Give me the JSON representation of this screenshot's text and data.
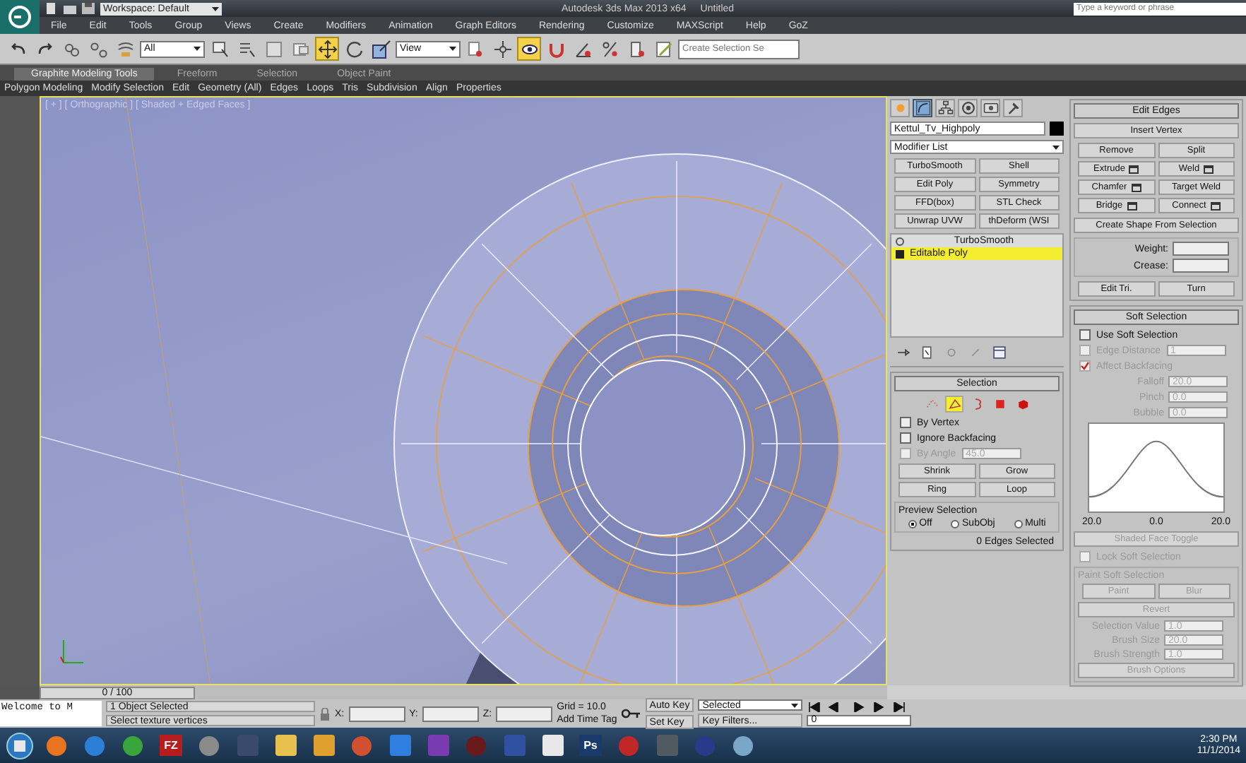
{
  "title_bar": {
    "workspace": "Workspace: Default",
    "title": "Autodesk 3ds Max 2013 x64",
    "document": "Untitled",
    "search": {
      "placeholder": "Type a keyword or phrase"
    }
  },
  "menu": [
    "File",
    "Edit",
    "Tools",
    "Group",
    "Views",
    "Create",
    "Modifiers",
    "Animation",
    "Graph Editors",
    "Rendering",
    "Customize",
    "MAXScript",
    "Help",
    "GoZ"
  ],
  "toolbar": [
    {
      "kind": "undo",
      "selected": false
    },
    {
      "kind": "redo",
      "selected": false
    },
    {
      "kind": "link",
      "selected": false
    },
    {
      "kind": "unlink",
      "selected": false
    },
    {
      "kind": "bind",
      "selected": false
    },
    {
      "kind": "dropdown",
      "value": "All"
    },
    {
      "kind": "select",
      "selected": false
    },
    {
      "kind": "select-name",
      "selected": false
    },
    {
      "kind": "rect",
      "selected": false
    },
    {
      "kind": "window",
      "selected": false
    },
    {
      "kind": "move",
      "selected": true
    },
    {
      "kind": "rotate",
      "selected": false
    },
    {
      "kind": "scale",
      "selected": false
    },
    {
      "kind": "dropdown",
      "value": "View"
    },
    {
      "kind": "pivot",
      "selected": false
    },
    {
      "kind": "manip",
      "selected": false
    },
    {
      "kind": "keyboard",
      "selected": true
    },
    {
      "kind": "snap",
      "selected": false
    },
    {
      "kind": "angle",
      "selected": false
    },
    {
      "kind": "percent",
      "selected": false
    },
    {
      "kind": "spinner",
      "selected": false
    },
    {
      "kind": "named",
      "selected": false
    },
    {
      "kind": "field",
      "placeholder": "Create Selection Se"
    }
  ],
  "ribbon_tabs": [
    {
      "label": "Graphite Modeling Tools",
      "selected": true
    },
    {
      "label": "Freeform",
      "selected": false
    },
    {
      "label": "Selection",
      "selected": false
    },
    {
      "label": "Object Paint",
      "selected": false
    }
  ],
  "ribbon_panels": [
    "Polygon Modeling",
    "Modify Selection",
    "Edit",
    "Geometry (All)",
    "Edges",
    "Loops",
    "Tris",
    "Subdivision",
    "Align",
    "Properties"
  ],
  "viewport": {
    "label": "[ + ] [ Orthographic ] [ Shaded + Edged Faces ]"
  },
  "command_tabs": [
    {
      "kind": "create",
      "selected": false
    },
    {
      "kind": "modify",
      "selected": true
    },
    {
      "kind": "hierarchy",
      "selected": false
    },
    {
      "kind": "motion",
      "selected": false
    },
    {
      "kind": "display",
      "selected": false
    },
    {
      "kind": "utilities",
      "selected": false
    }
  ],
  "object_name": "Kettul_Tv_Highpoly",
  "modifier_list": "Modifier List",
  "modifier_buttons": [
    "TurboSmooth",
    "Shell",
    "Edit Poly",
    "Symmetry",
    "FFD(box)",
    "STL Check",
    "Unwrap UVW",
    "thDeform (WSI"
  ],
  "stack": [
    {
      "label": "TurboSmooth",
      "kind": "modifier",
      "selected": false
    },
    {
      "label": "Editable Poly",
      "kind": "base",
      "selected": true
    }
  ],
  "selection": {
    "title": "Selection",
    "subobjects": [
      {
        "kind": "vertex",
        "selected": false
      },
      {
        "kind": "edge",
        "selected": true
      },
      {
        "kind": "border",
        "selected": false
      },
      {
        "kind": "polygon",
        "selected": false
      },
      {
        "kind": "element",
        "selected": false
      }
    ],
    "options": [
      {
        "label": "By Vertex",
        "checked": false,
        "disabled": false
      },
      {
        "label": "Ignore Backfacing",
        "checked": false,
        "disabled": false
      },
      {
        "label": "By Angle",
        "checked": false,
        "disabled": true,
        "value": "45.0"
      }
    ],
    "buttons": [
      "Shrink",
      "Grow",
      "Ring",
      "Loop"
    ],
    "preview_title": "Preview Selection",
    "preview": [
      {
        "label": "Off",
        "selected": true
      },
      {
        "label": "SubObj",
        "selected": false
      },
      {
        "label": "Multi",
        "selected": false
      }
    ],
    "status": "0 Edges Selected"
  },
  "edit_edges": {
    "title": "Edit Edges",
    "insert": "Insert Vertex",
    "buttons": [
      {
        "label": "Remove",
        "settings": false
      },
      {
        "label": "Split",
        "settings": false
      },
      {
        "label": "Extrude",
        "settings": true
      },
      {
        "label": "Weld",
        "settings": true
      },
      {
        "label": "Chamfer",
        "settings": true
      },
      {
        "label": "Target Weld",
        "settings": false
      },
      {
        "label": "Bridge",
        "settings": true
      },
      {
        "label": "Connect",
        "settings": true
      }
    ],
    "create_shape": "Create Shape From Selection",
    "weight": "Weight:",
    "crease": "Crease:",
    "edit_tri": "Edit Tri.",
    "turn": "Turn"
  },
  "soft_selection": {
    "title": "Soft Selection",
    "use": {
      "label": "Use Soft Selection",
      "checked": false
    },
    "edge_distance": {
      "label": "Edge Distance",
      "checked": false,
      "value": "1"
    },
    "affect_backfacing": {
      "label": "Affect Backfacing",
      "checked": true
    },
    "spinners": [
      {
        "label": "Falloff",
        "value": "20.0"
      },
      {
        "label": "Pinch",
        "value": "0.0"
      },
      {
        "label": "Bubble",
        "value": "0.0"
      }
    ],
    "curve_labels": [
      "20.0",
      "0.0",
      "20.0"
    ],
    "shaded_toggle": "Shaded Face Toggle",
    "lock": {
      "label": "Lock Soft Selection",
      "checked": false
    },
    "paint_title": "Paint Soft Selection",
    "paint": "Paint",
    "blur": "Blur",
    "revert": "Revert",
    "brush": [
      {
        "label": "Selection Value",
        "value": "1.0"
      },
      {
        "label": "Brush Size",
        "value": "20.0"
      },
      {
        "label": "Brush Strength",
        "value": "1.0"
      }
    ],
    "brush_options": "Brush Options"
  },
  "time_slider": {
    "label": "0 / 100",
    "level": 0
  },
  "status_bar": {
    "listener": "Welcome to M",
    "selected": "1 Object Selected",
    "prompt": "Select texture vertices",
    "x": "X:",
    "y": "Y:",
    "z": "Z:",
    "grid": "Grid = 10.0",
    "time_tag": "Add Time Tag",
    "auto_key": "Auto Key",
    "key_mode": "Selected",
    "set_key": "Set Key",
    "key_filters": "Key Filters...",
    "frame": "0"
  },
  "taskbar": {
    "apps": [
      {
        "kind": "round",
        "color": "#e8741e"
      },
      {
        "kind": "round",
        "color": "#2d7fd6"
      },
      {
        "kind": "round",
        "color": "#3aa53a"
      },
      {
        "kind": "text",
        "label": "FZ",
        "color": "#b81c1c"
      },
      {
        "kind": "round",
        "color": "#8a8a8a"
      },
      {
        "kind": "square",
        "color": "#3a4a6a"
      },
      {
        "kind": "square",
        "color": "#e8c050"
      },
      {
        "kind": "square",
        "color": "#e0a030"
      },
      {
        "kind": "round",
        "color": "#d05030"
      },
      {
        "kind": "square",
        "color": "#2e7fe0"
      },
      {
        "kind": "square",
        "color": "#7a3ab0"
      },
      {
        "kind": "round",
        "color": "#6a1a1a"
      },
      {
        "kind": "square",
        "color": "#3050a0"
      },
      {
        "kind": "square",
        "color": "#e8e8e8"
      },
      {
        "kind": "text",
        "label": "Ps",
        "color": "#1a3a6a"
      },
      {
        "kind": "round",
        "color": "#c02828"
      },
      {
        "kind": "square",
        "color": "#505a60"
      },
      {
        "kind": "round",
        "color": "#2a3a8a"
      },
      {
        "kind": "round",
        "color": "#7aa6c8"
      }
    ],
    "time": "2:30 PM",
    "date": "11/1/2014"
  }
}
